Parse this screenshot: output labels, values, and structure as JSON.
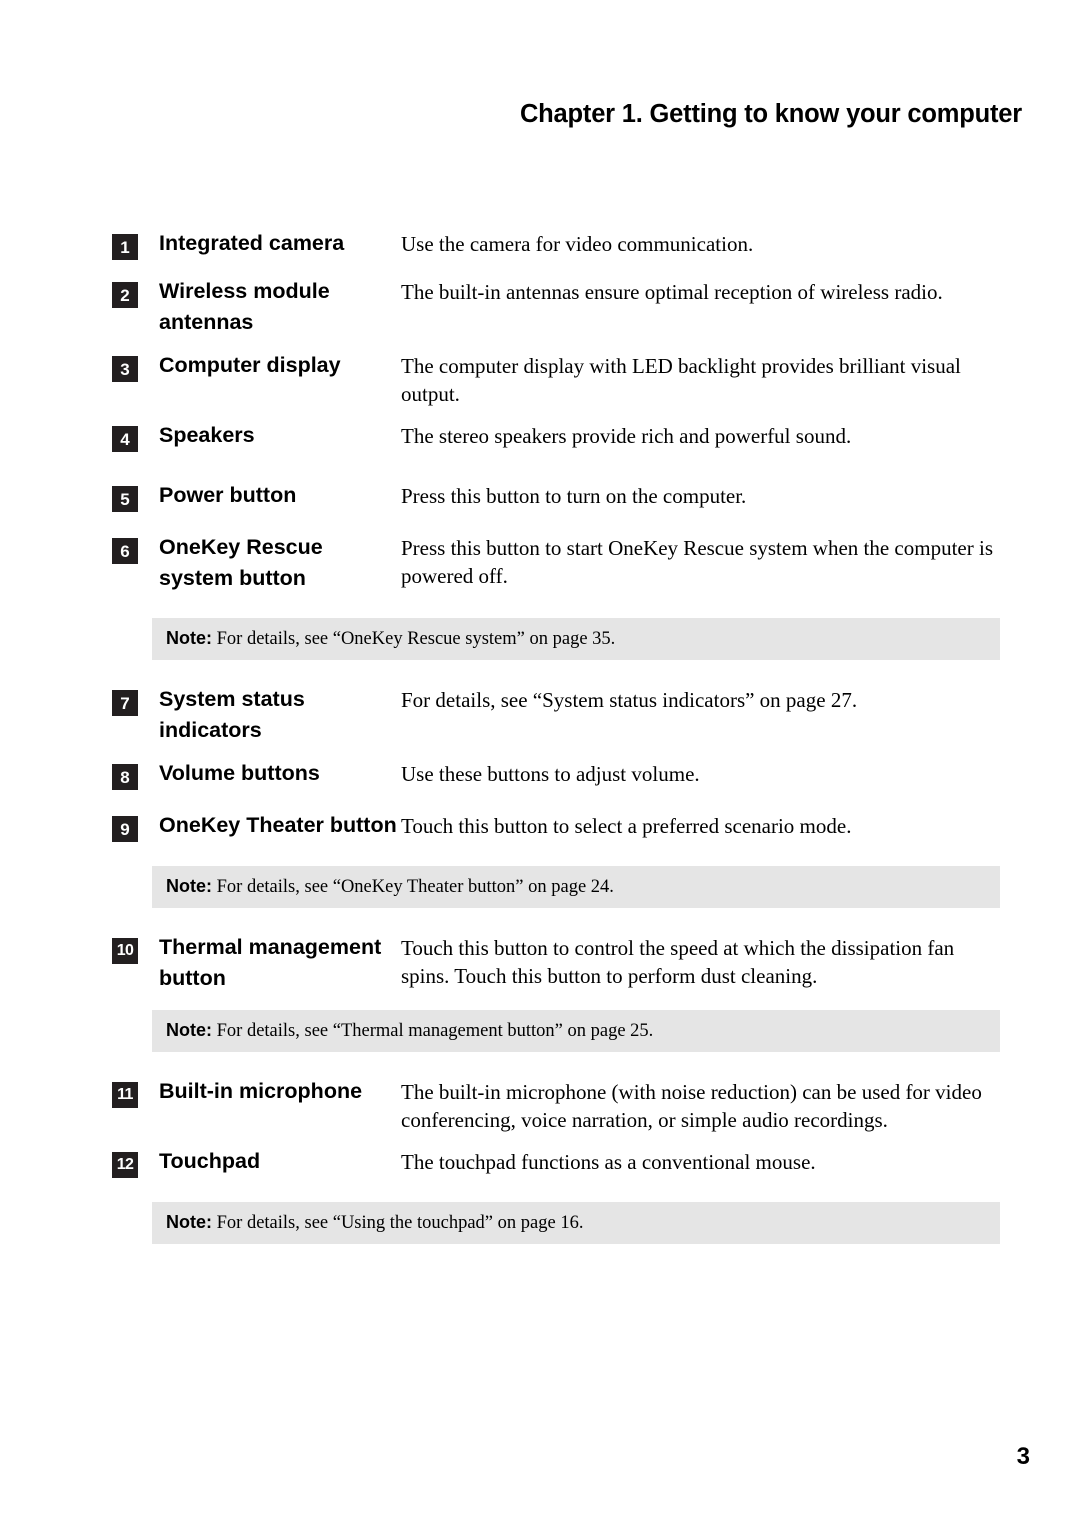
{
  "header": {
    "chapter_title": "Chapter 1. Getting to know your computer"
  },
  "footer": {
    "page_number": "3"
  },
  "colors": {
    "badge_background": "#231f20",
    "badge_text": "#ffffff",
    "note_background": "#e5e5e5",
    "page_background": "#ffffff",
    "text": "#000000"
  },
  "note_word": "Note:",
  "features": [
    {
      "number": "1",
      "label": "Integrated camera",
      "description": "Use the camera for video communication."
    },
    {
      "number": "2",
      "label": "Wireless module antennas",
      "description": "The built-in antennas ensure optimal reception of wireless radio."
    },
    {
      "number": "3",
      "label": "Computer display",
      "description": "The computer display with LED backlight provides brilliant visual output."
    },
    {
      "number": "4",
      "label": "Speakers",
      "description": "The stereo speakers provide rich and powerful sound."
    },
    {
      "number": "5",
      "label": "Power button",
      "description": "Press this button to turn on the computer."
    },
    {
      "number": "6",
      "label": "OneKey Rescue system button",
      "description": "Press this button to start OneKey Rescue system when the computer is powered off."
    },
    {
      "number": "7",
      "label": "System status indicators",
      "description": "For details, see “System status indicators” on page 27."
    },
    {
      "number": "8",
      "label": "Volume buttons",
      "description": "Use these buttons to adjust volume."
    },
    {
      "number": "9",
      "label": "OneKey Theater button",
      "description": "Touch this button to select a preferred scenario mode."
    },
    {
      "number": "10",
      "label": "Thermal management button",
      "description": "Touch this button to control the speed at which the dissipation fan spins. Touch this button to perform dust cleaning."
    },
    {
      "number": "11",
      "label": "Built-in microphone",
      "description": "The built-in microphone (with noise reduction) can be used for video conferencing, voice narration, or simple audio recordings."
    },
    {
      "number": "12",
      "label": "Touchpad",
      "description": "The touchpad functions as a conventional mouse."
    }
  ],
  "notes": [
    {
      "id": "note-onekey-rescue",
      "text": "For details, see “OneKey Rescue system” on page 35."
    },
    {
      "id": "note-onekey-theater",
      "text": "For details, see “OneKey Theater button” on page 24."
    },
    {
      "id": "note-thermal-management",
      "text": "For details, see “Thermal management button” on page 25."
    },
    {
      "id": "note-using-touchpad",
      "text": "For details, see “Using the touchpad” on page 16."
    }
  ]
}
